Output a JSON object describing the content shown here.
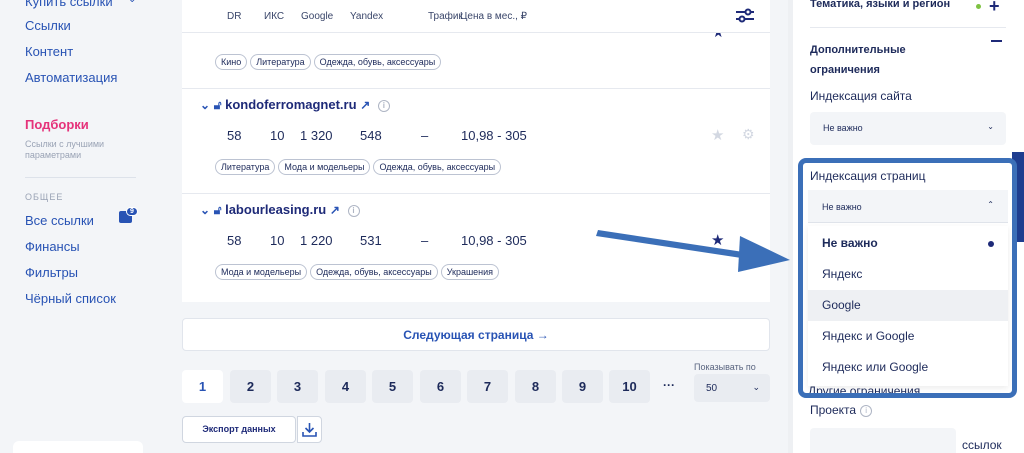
{
  "sidebar": {
    "top_partial": "Купить ссылки",
    "items": [
      {
        "label": "Ссылки"
      },
      {
        "label": "Контент"
      },
      {
        "label": "Автоматизация"
      }
    ],
    "active": {
      "label": "Подборки",
      "sub": "Ссылки с лучшими параметрами"
    },
    "section_label": "ОБЩЕЕ",
    "general": [
      {
        "label": "Все ссылки",
        "badge": "9"
      },
      {
        "label": "Финансы"
      },
      {
        "label": "Фильтры"
      },
      {
        "label": "Чёрный список"
      }
    ]
  },
  "table": {
    "headers": [
      "DR",
      "ИКС",
      "Google",
      "Yandex",
      "Трафик",
      "Цена в мес., ₽"
    ],
    "rows": [
      {
        "site": "",
        "tags": [
          "Кино",
          "Литература",
          "Одежда, обувь, аксессуары"
        ]
      },
      {
        "site": "kondoferromagnet.ru",
        "dr": "58",
        "iks": "10",
        "google": "1 320",
        "yandex": "548",
        "traffic": "–",
        "price": "10,98 - 305",
        "tags": [
          "Литература",
          "Мода и модельеры",
          "Одежда, обувь, аксессуары"
        ]
      },
      {
        "site": "labourleasing.ru",
        "dr": "58",
        "iks": "10",
        "google": "1 220",
        "yandex": "531",
        "traffic": "–",
        "price": "10,98 - 305",
        "tags": [
          "Мода и модельеры",
          "Одежда, обувь, аксессуары",
          "Украшения"
        ]
      }
    ]
  },
  "next_page": "Следующая страница →",
  "pagination": {
    "pages": [
      "1",
      "2",
      "3",
      "4",
      "5",
      "6",
      "7",
      "8",
      "9",
      "10"
    ],
    "current": "1",
    "ellipsis": "···",
    "show_label": "Показывать по",
    "show_value": "50"
  },
  "export_label": "Экспорт данных",
  "filters": {
    "theme_title": "Тематика, языки и регион",
    "extra_title": "Дополнительные ограничения",
    "site_index_label": "Индексация сайта",
    "site_index_value": "Не важно",
    "page_index_label": "Индексация страниц",
    "page_index_value": "Не важно",
    "page_index_options": [
      "Не важно",
      "Яндекс",
      "Google",
      "Яндекс и Google",
      "Яндекс или Google"
    ],
    "page_index_selected": "Не важно",
    "page_index_hover": "Google",
    "hidden_label_partial": "Другие ограничения",
    "project_label": "Проекта",
    "links_label": "ссылок"
  },
  "colors": {
    "accent": "#2853b4",
    "active_pink": "#e5327a",
    "navy": "#1e2a78",
    "highlight_frame": "#3b6fb8",
    "green_dot": "#7ec242"
  }
}
